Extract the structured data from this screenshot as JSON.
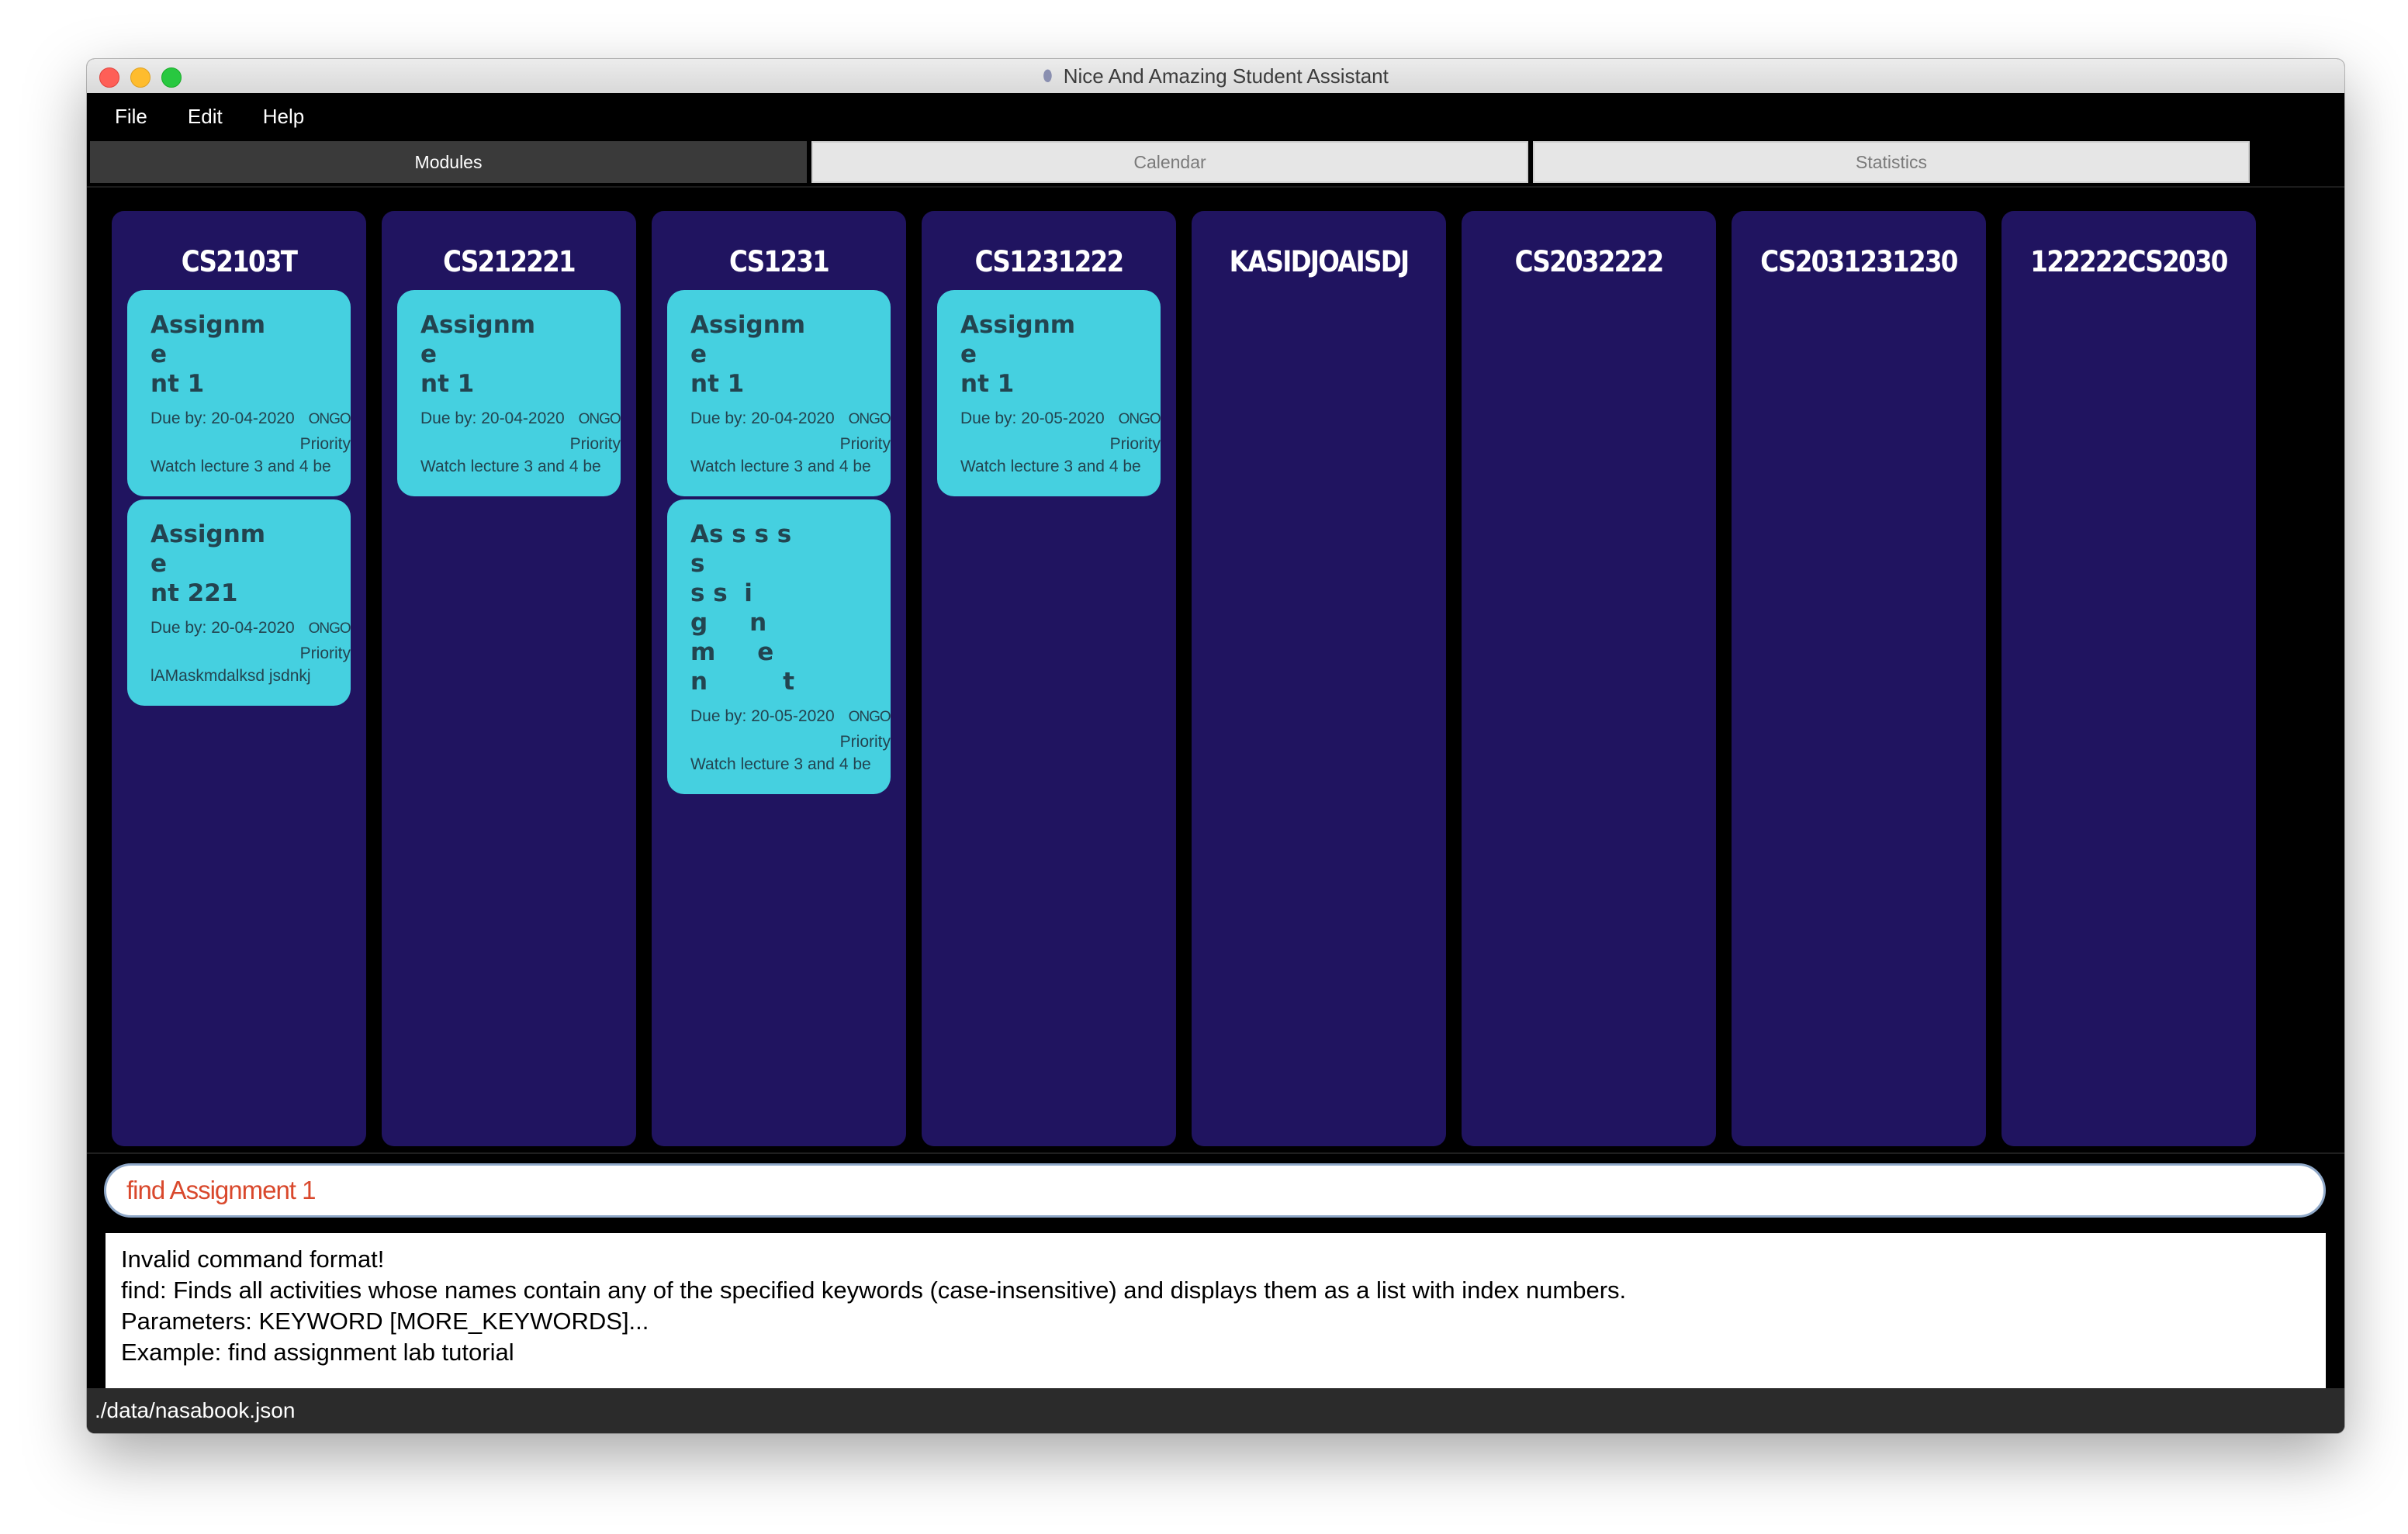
{
  "window": {
    "title": "Nice And Amazing Student Assistant",
    "title_icon": "app-icon"
  },
  "menu": {
    "items": [
      "File",
      "Edit",
      "Help"
    ]
  },
  "tabs": [
    {
      "label": "Modules",
      "active": true
    },
    {
      "label": "Calendar",
      "active": false
    },
    {
      "label": "Statistics",
      "active": false
    }
  ],
  "modules": [
    {
      "code": "CS2103T",
      "cards": [
        {
          "name": "Assignme\nnt 1",
          "due": "Due by: 20-04-2020",
          "status": "ONGOI",
          "priority": "Priority",
          "note": "Watch lecture 3 and 4 be"
        },
        {
          "name": "Assignme\nnt 221",
          "due": "Due by: 20-04-2020",
          "status": "ONGOI",
          "priority": "Priority",
          "note": "lAMaskmdalksd    jsdnkj"
        }
      ]
    },
    {
      "code": "CS212221",
      "cards": [
        {
          "name": "Assignme\nnt 1",
          "due": "Due by: 20-04-2020",
          "status": "ONGOI",
          "priority": "Priority",
          "note": "Watch lecture 3 and 4 be"
        }
      ]
    },
    {
      "code": "CS1231",
      "cards": [
        {
          "name": "Assignme\nnt 1",
          "due": "Due by: 20-04-2020",
          "status": "ONGOI",
          "priority": "Priority",
          "note": "Watch lecture 3 and 4 be"
        },
        {
          "name": "As s s s s\ns s  i\ng     n\nm     e\nn         t",
          "due": "Due by: 20-05-2020",
          "status": "ONGOI",
          "priority": "Priority",
          "note": "Watch lecture 3 and 4 be"
        }
      ]
    },
    {
      "code": "CS1231222",
      "cards": [
        {
          "name": "Assignme\nnt 1",
          "due": "Due by: 20-05-2020",
          "status": "ONGOI",
          "priority": "Priority",
          "note": "Watch lecture 3 and 4 be"
        }
      ]
    },
    {
      "code": "KASIDJOAISDJ",
      "cards": []
    },
    {
      "code": "CS2032222",
      "cards": []
    },
    {
      "code": "CS2031231230",
      "cards": []
    },
    {
      "code": "122222CS2030",
      "cards": []
    }
  ],
  "command": {
    "value": "find Assignment 1"
  },
  "result": {
    "lines": [
      "Invalid command format!",
      "find: Finds all activities whose names contain any of the specified keywords (case-insensitive) and displays them as a list with index numbers.",
      "Parameters: KEYWORD [MORE_KEYWORDS]...",
      "Example: find assignment lab tutorial"
    ]
  },
  "status_bar": {
    "path": "./data/nasabook.json"
  }
}
